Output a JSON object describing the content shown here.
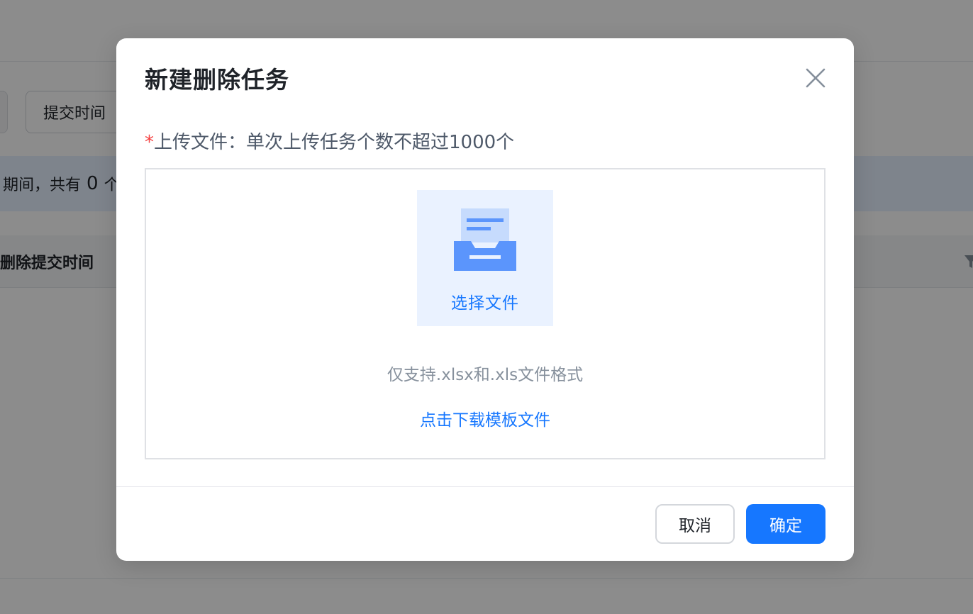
{
  "background": {
    "filter_button_label": "提交时间",
    "info_bar_text": "期间，共有",
    "info_bar_count": "0",
    "info_bar_suffix": "个",
    "table_header_label": "删除提交时间"
  },
  "modal": {
    "title": "新建删除任务",
    "field": {
      "required_mark": "*",
      "label": "上传文件：单次上传任务个数不超过1000个"
    },
    "upload": {
      "select_file_label": "选择文件",
      "support_hint": "仅支持.xlsx和.xls文件格式",
      "download_template_label": "点击下载模板文件"
    },
    "footer": {
      "cancel_label": "取消",
      "confirm_label": "确定"
    }
  },
  "colors": {
    "primary": "#1677ff",
    "required": "#f53f3f",
    "icon_light": "#c6dbfd",
    "icon_dark": "#5b95fc"
  }
}
